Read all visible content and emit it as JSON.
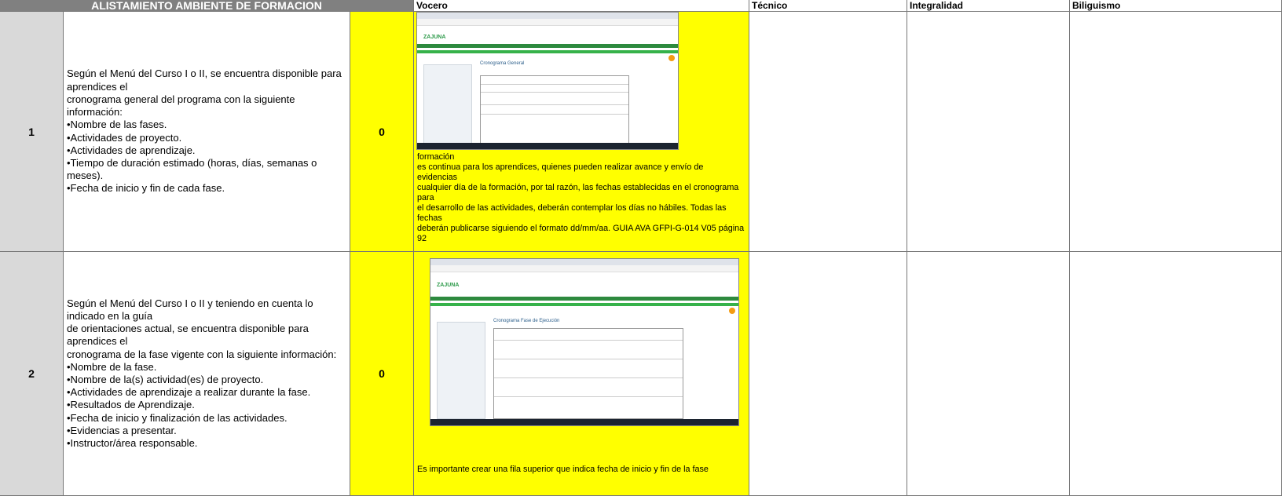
{
  "header": {
    "main": "ALISTAMIENTO AMBIENTE DE FORMACION",
    "vocero": "Vocero",
    "tecnico": "Técnico",
    "integralidad": "Integralidad",
    "bilinguismo": "Biliguismo"
  },
  "rows": [
    {
      "number": "1",
      "description": "Según el Menú del Curso I o II, se encuentra disponible para aprendices el\ncronograma general del programa con la siguiente información:\n•Nombre de las fases.\n•Actividades de proyecto.\n•Actividades de aprendizaje.\n•Tiempo de duración estimado (horas, días, semanas o meses).\n•Fecha de inicio y fin de cada fase.",
      "score": "0",
      "vocero_note": "formación\nes continua para los aprendices, quienes pueden realizar avance y envío de evidencias\ncualquier día de la formación, por tal razón, las fechas establecidas en el cronograma para\nel desarrollo de las actividades, deberán contemplar los días no hábiles. Todas las fechas\ndeberán publicarse siguiendo el formato dd/mm/aa. GUIA AVA GFPI-G-014 V05 página 92",
      "screenshot": {
        "logo": "ZAJUNA",
        "title": "Cronograma General"
      }
    },
    {
      "number": "2",
      "description": "Según el Menú del Curso I o II y teniendo en cuenta lo indicado en la guía\nde orientaciones actual, se encuentra disponible para aprendices el\ncronograma de la fase vigente con la siguiente información:\n•Nombre de la fase.\n•Nombre de la(s) actividad(es) de proyecto.\n•Actividades de aprendizaje a realizar durante la fase.\n•Resultados de Aprendizaje.\n•Fecha de inicio y finalización de las actividades.\n•Evidencias a presentar.\n•Instructor/área responsable.",
      "score": "0",
      "vocero_note": "Es importante crear una fila superior que indica fecha de inicio y fin de la fase",
      "screenshot": {
        "logo": "ZAJUNA",
        "title": "Cronograma Fase de Ejecución"
      }
    }
  ],
  "colors": {
    "highlight": "#ffff00",
    "header_bg": "#808080",
    "number_bg": "#d9d9d9",
    "zajuna_green": "#2d8a3e"
  }
}
